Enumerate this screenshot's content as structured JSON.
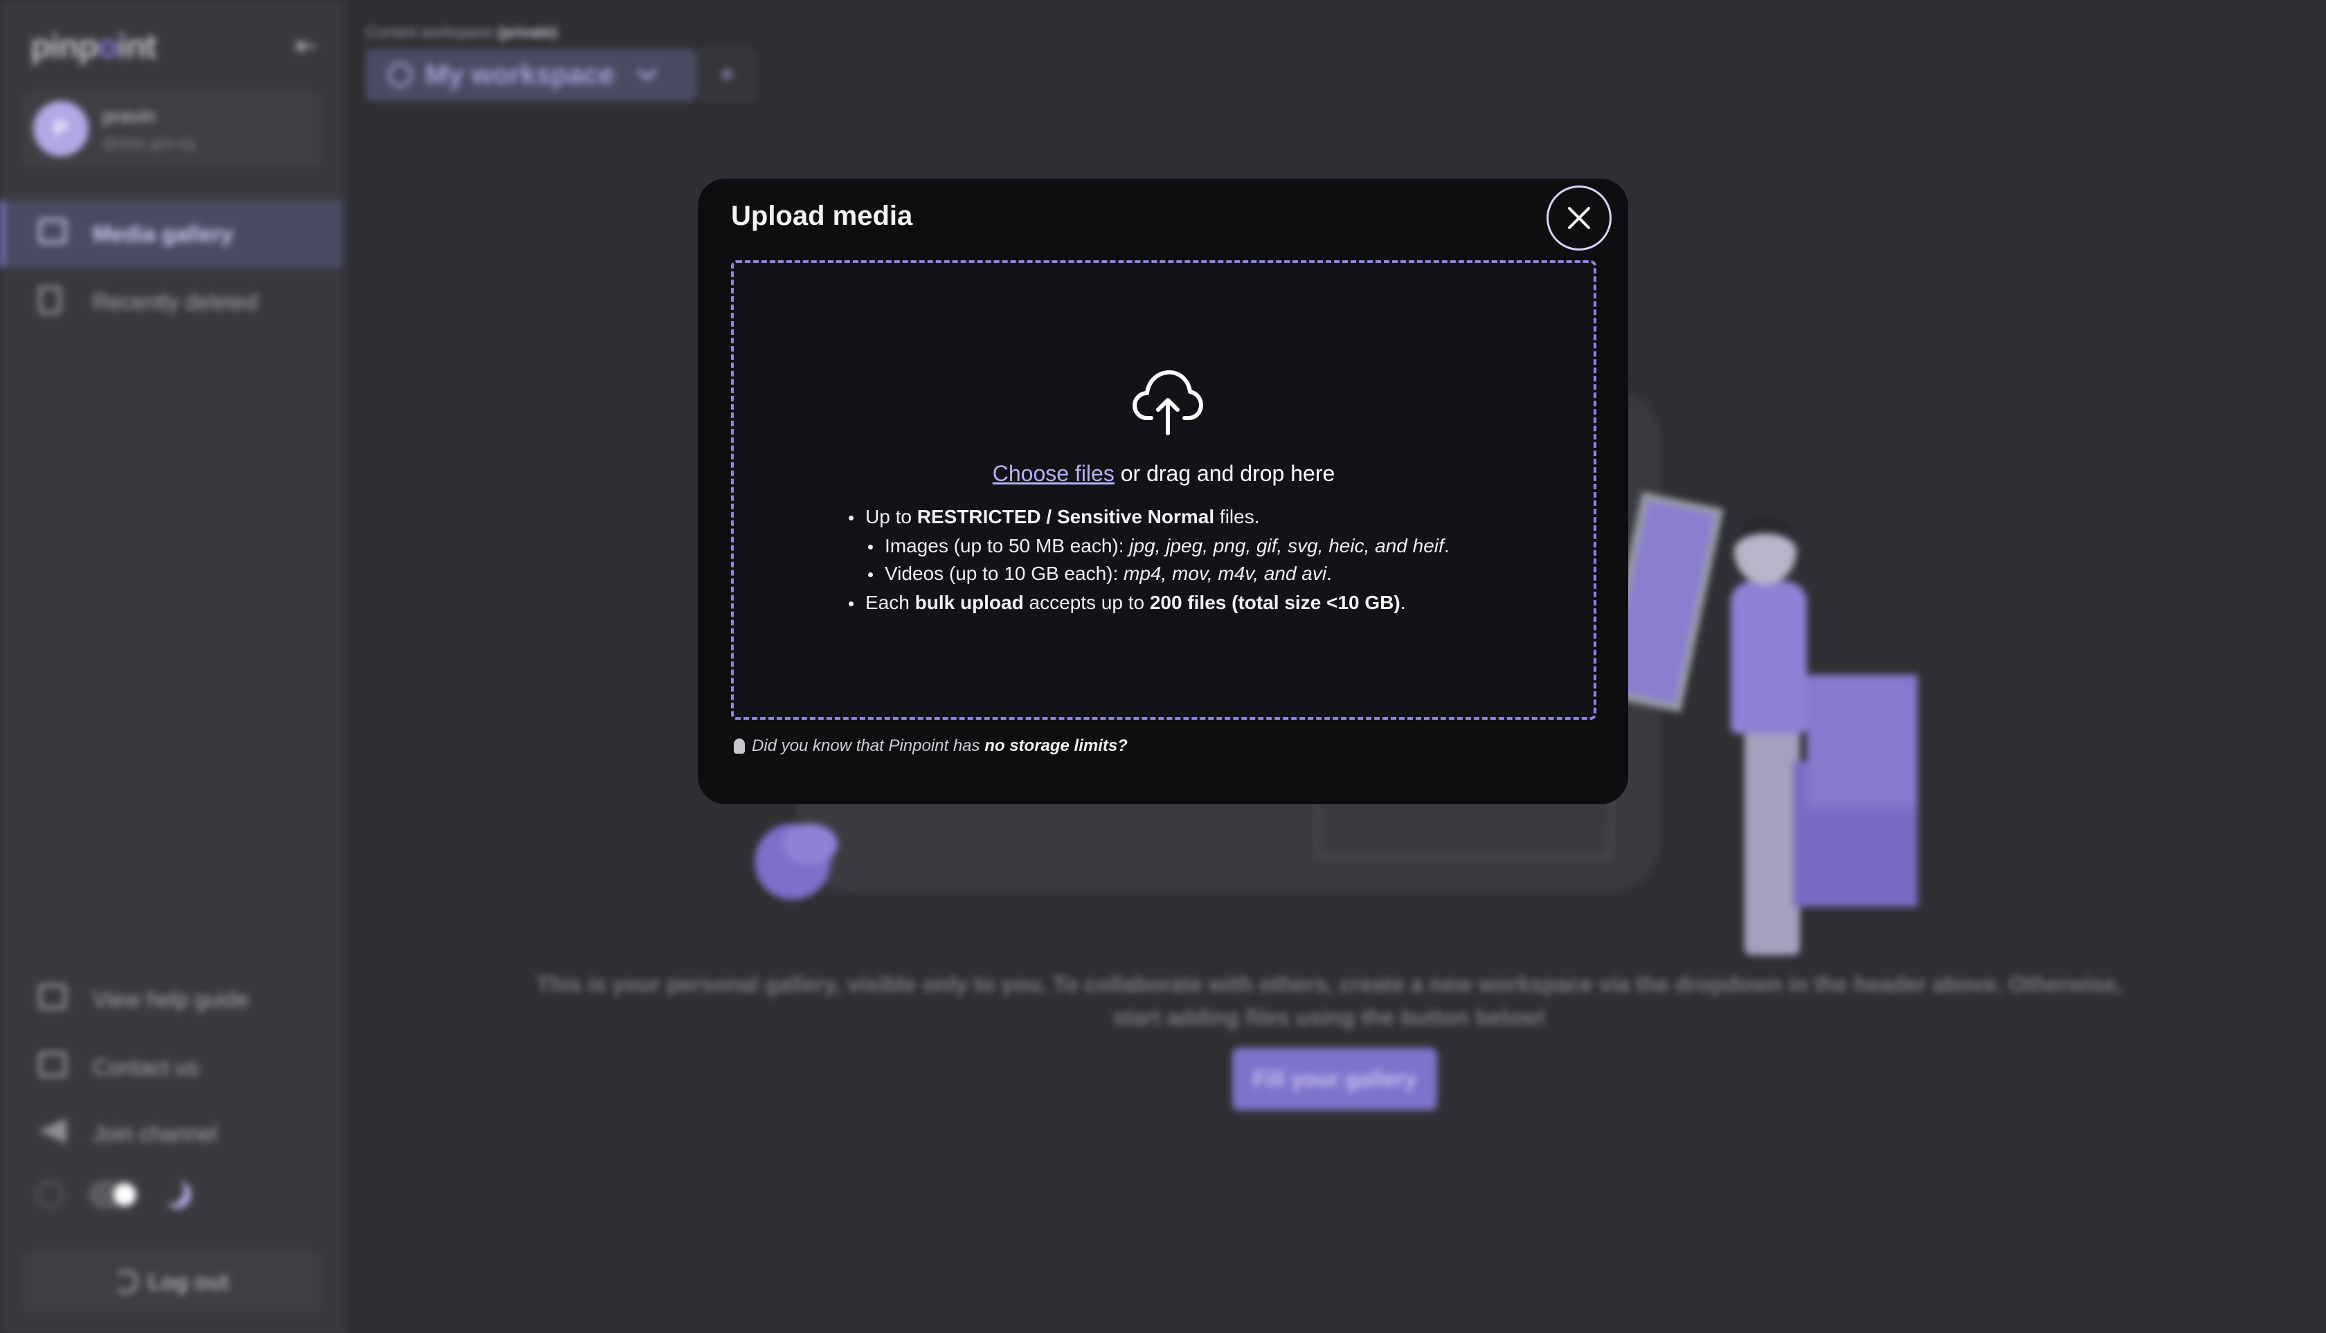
{
  "sidebar": {
    "logo_prefix": "pinp",
    "logo_dot": "o",
    "logo_suffix": "int",
    "user": {
      "initial": "P",
      "name": "pravin",
      "email": "@dotc.gov.sg"
    },
    "nav": [
      {
        "label": "Media gallery",
        "icon": "image-icon",
        "active": true
      },
      {
        "label": "Recently deleted",
        "icon": "trash-icon",
        "active": false
      }
    ],
    "footer_nav": [
      {
        "label": "View help guide",
        "icon": "book-icon"
      },
      {
        "label": "Contact us",
        "icon": "mail-icon"
      },
      {
        "label": "Join channel",
        "icon": "send-icon"
      }
    ],
    "logout_label": "Log out"
  },
  "header": {
    "workspace_label": "Current workspace",
    "workspace_tag": "(private)",
    "workspace_name": "My workspace",
    "add_label": "+"
  },
  "main": {
    "empty_text": "This is your personal gallery, visible only to you. To collaborate with others, create a new workspace via the dropdown in the header above. Otherwise, start adding files using the button below!",
    "fill_button": "Fill your gallery"
  },
  "modal": {
    "title": "Upload media",
    "choose_link": "Choose files",
    "choose_rest": " or drag and drop here",
    "rule1": {
      "pre": "Up to ",
      "bold": "RESTRICTED / Sensitive Normal",
      "post": " files."
    },
    "rule1a": {
      "pre": "Images (up to 50 MB each): ",
      "italic": "jpg, jpeg, png, gif, svg, heic, and heif",
      "post": "."
    },
    "rule1b": {
      "pre": "Videos (up to 10 GB each): ",
      "italic": "mp4, mov, m4v, and avi",
      "post": "."
    },
    "rule2": {
      "pre": "Each ",
      "bold1": "bulk upload",
      "mid": " accepts up to ",
      "bold2": "200 files (total size <10 GB)",
      "post": "."
    },
    "tip": {
      "pre": "Did you know that Pinpoint has ",
      "bold": "no storage limits?"
    }
  },
  "colors": {
    "accent": "#8f83e6",
    "modal_bg": "#0d0e10",
    "page_bg": "#2f3033"
  }
}
